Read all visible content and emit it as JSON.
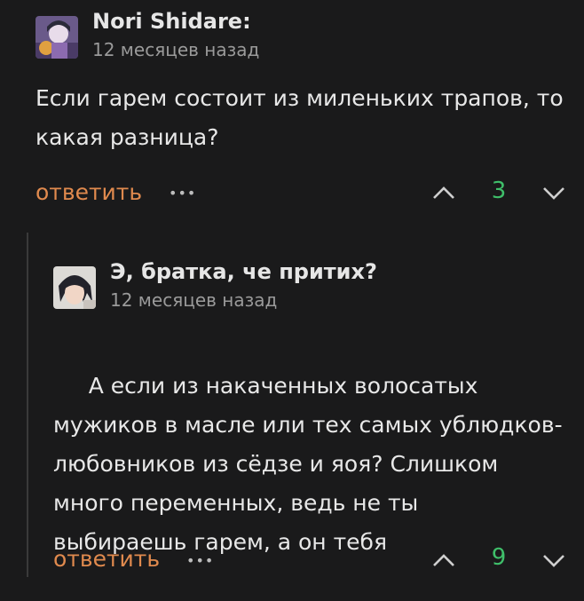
{
  "comments": [
    {
      "author": "Nori Shidare:",
      "time": "12 месяцев назад",
      "lines": [
        "Если гарем состоит из миленьких трапов, то",
        "какая разница?"
      ],
      "reply_label": "ответить",
      "more": "•••",
      "score": "3",
      "upvote_icon": "chevron-up-icon",
      "downvote_icon": "chevron-down-icon"
    },
    {
      "author": "Э, братка, че притих?",
      "time": "12 месяцев назад",
      "lines": [
        " А если из накаченных волосатых",
        "мужиков в масле или тех самых ублюдков-",
        "любовников из сёдзе и яоя? Слишком",
        "много переменных, ведь не ты",
        "выбираешь гарем, а он тебя"
      ],
      "reply_label": "ответить",
      "more": "•••",
      "score": "9",
      "upvote_icon": "chevron-up-icon",
      "downvote_icon": "chevron-down-icon"
    }
  ],
  "colors": {
    "background": "#1a1a1b",
    "reply_link": "#e08a4e",
    "score": "#3fbf6a",
    "muted": "#9a9a9a"
  }
}
